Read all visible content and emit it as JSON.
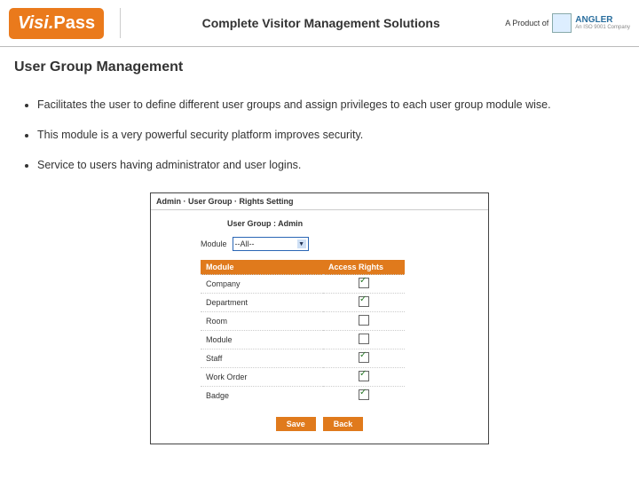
{
  "header": {
    "logo_left": "Visi.",
    "logo_right": "Pass",
    "tagline": "Complete Visitor Management Solutions",
    "aproduct": "A Product of",
    "angler_name": "ANGLER",
    "angler_sub": "An ISO 9001 Company"
  },
  "title": "User Group Management",
  "bullets": [
    "Facilitates the user to define different user groups and assign privileges to each user group module wise.",
    "This module is a very powerful security platform improves security.",
    "Service to users having administrator and user logins."
  ],
  "screenshot": {
    "breadcrumb": "Admin · User Group · Rights Setting",
    "caption": "User Group : Admin",
    "module_label": "Module",
    "module_value": "--All--",
    "col1": "Module",
    "col2": "Access Rights",
    "rows": [
      {
        "name": "Company",
        "checked": true
      },
      {
        "name": "Department",
        "checked": true
      },
      {
        "name": "Room",
        "checked": false
      },
      {
        "name": "Module",
        "checked": false
      },
      {
        "name": "Staff",
        "checked": true
      },
      {
        "name": "Work Order",
        "checked": true
      },
      {
        "name": "Badge",
        "checked": true
      }
    ],
    "save": "Save",
    "back": "Back"
  }
}
